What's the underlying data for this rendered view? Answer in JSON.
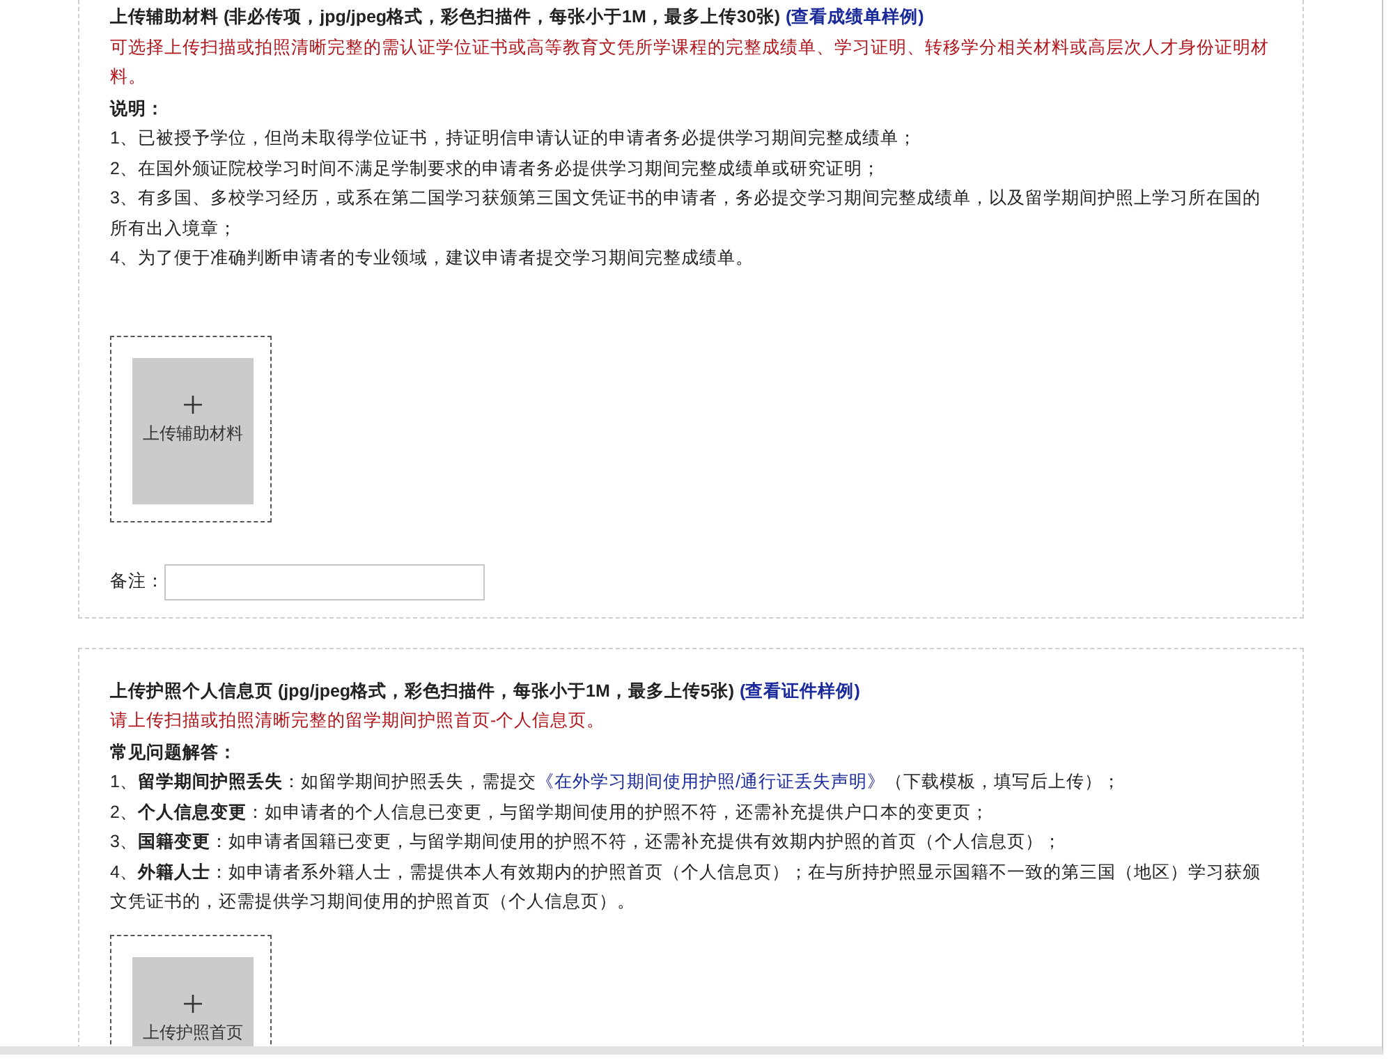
{
  "sections": [
    {
      "title": "上传辅助材料 (非必传项，jpg/jpeg格式，彩色扫描件，每张小于1M，最多上传30张)",
      "title_link": "(查看成绩单样例)",
      "note": "可选择上传扫描或拍照清晰完整的需认证学位证书或高等教育文凭所学课程的完整成绩单、学习证明、转移学分相关材料或高层次人才身份证明材料。",
      "heading": "说明：",
      "items": [
        {
          "text": "1、已被授予学位，但尚未取得学位证书，持证明信申请认证的申请者务必提供学习期间完整成绩单；"
        },
        {
          "text": "2、在国外颁证院校学习时间不满足学制要求的申请者务必提供学习期间完整成绩单或研究证明；"
        },
        {
          "text": "3、有多国、多校学习经历，或系在第二国学习获颁第三国文凭证书的申请者，务必提交学习期间完整成绩单，以及留学期间护照上学习所在国的所有出入境章；"
        },
        {
          "text": "4、为了便于准确判断申请者的专业领域，建议申请者提交学习期间完整成绩单。"
        }
      ],
      "upload": {
        "label": "上传辅助材料"
      },
      "remark": {
        "label": "备注："
      }
    },
    {
      "title": "上传护照个人信息页 (jpg/jpeg格式，彩色扫描件，每张小于1M，最多上传5张)",
      "title_link": "(查看证件样例)",
      "note": "请上传扫描或拍照清晰完整的留学期间护照首页-个人信息页。",
      "heading": "常见问题解答：",
      "items": [
        {
          "text": "1、**留学期间护照丢失**：如留学期间护照丢失，需提交",
          "link": "《在外学习期间使用护照/通行证丢失声明》",
          "tail": "（下载模板，填写后上传）；"
        },
        {
          "text": "2、**个人信息变更**：如申请者的个人信息已变更，与留学期间使用的护照不符，还需补充提供户口本的变更页；"
        },
        {
          "text": "3、**国籍变更**：如申请者国籍已变更，与留学期间使用的护照不符，还需补充提供有效期内护照的首页（个人信息页）；"
        },
        {
          "text": "4、**外籍人士**：如申请者系外籍人士，需提供本人有效期内的护照首页（个人信息页）；在与所持护照显示国籍不一致的第三国（地区）学习获颁文凭证书的，还需提供学习期间使用的护照首页（个人信息页）。"
        }
      ],
      "upload": {
        "label": "上传护照首页"
      }
    }
  ]
}
